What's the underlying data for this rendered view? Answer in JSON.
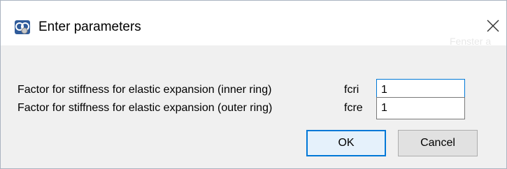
{
  "window": {
    "title": "Enter parameters",
    "ghost_text": "Fenster a"
  },
  "icons": {
    "app": "app-logo-icon",
    "close": "close-icon"
  },
  "params": [
    {
      "label": "Factor for stiffness for elastic expansion (inner ring)",
      "name": "fcri",
      "value": "1"
    },
    {
      "label": "Factor for stiffness for elastic expansion (outer ring)",
      "name": "fcre",
      "value": "1"
    }
  ],
  "buttons": {
    "ok_label": "OK",
    "cancel_label": "Cancel"
  },
  "colors": {
    "focus_accent": "#0078d7",
    "dialog_background": "#f0f0f0",
    "titlebar_background": "#ffffff"
  }
}
